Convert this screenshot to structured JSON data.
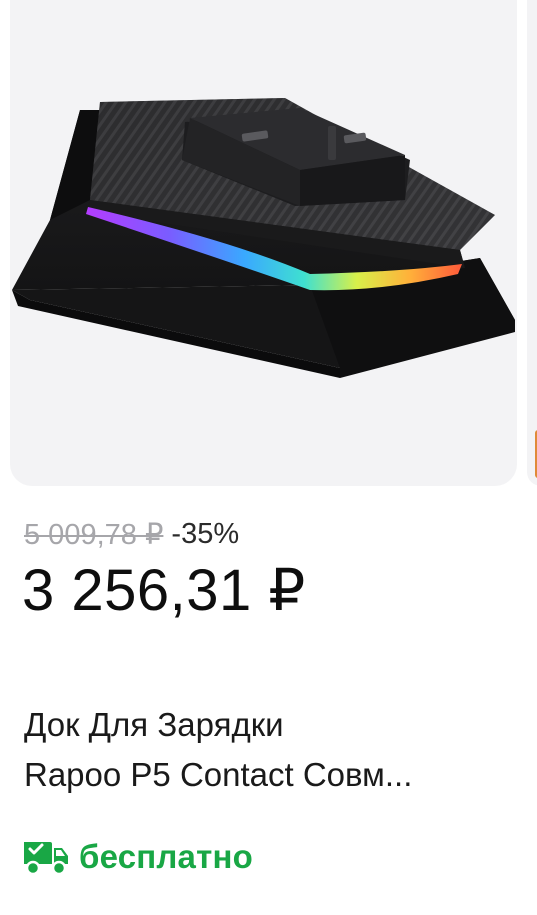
{
  "product": {
    "image_alt": "Rapoo P5 charging dock with RGB light strip",
    "old_price": "5 009,78 ₽",
    "discount": "-35%",
    "price": "3 256,31 ₽",
    "title_line1": "Док Для Зарядки",
    "title_line2": "Rapoo P5 Contact Совм...",
    "delivery": "бесплатно",
    "delivery_icon": "truck-icon"
  },
  "colors": {
    "old_price": "#a6a6aa",
    "delivery_green": "#19a745",
    "image_background": "#f3f3f5"
  }
}
